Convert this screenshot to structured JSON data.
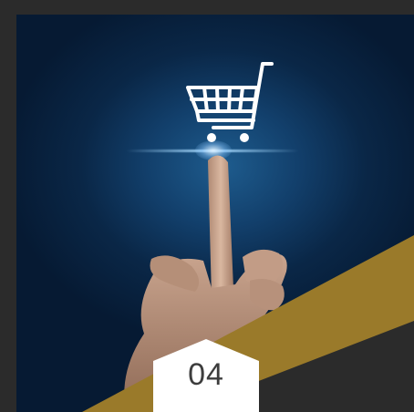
{
  "card": {
    "step_number": "04"
  },
  "icons": {
    "cart": "shopping-cart-icon"
  },
  "colors": {
    "frame_background": "#2b2b2b",
    "photo_background": "#0a2747",
    "accent_gold": "#9a7a2a",
    "badge_fill": "#ffffff",
    "number_text": "#3d3d3d",
    "cart_stroke": "#ffffff"
  }
}
